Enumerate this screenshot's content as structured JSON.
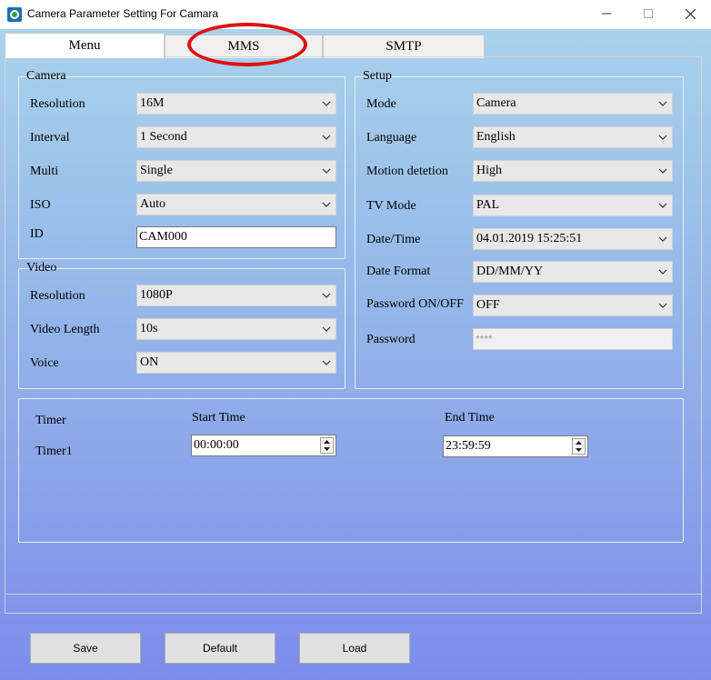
{
  "window": {
    "title": "Camera Parameter Setting For  Camara",
    "minimize_icon": "minimize-icon",
    "maximize_icon": "maximize-icon",
    "close_icon": "close-icon"
  },
  "tabs": [
    "Menu",
    "MMS",
    "SMTP"
  ],
  "active_tab": "Menu",
  "camera": {
    "group_title": "Camera",
    "resolution": {
      "label": "Resolution",
      "value": "16M"
    },
    "interval": {
      "label": "Interval",
      "value": "1 Second"
    },
    "multi": {
      "label": "Multi",
      "value": "Single"
    },
    "iso": {
      "label": "ISO",
      "value": "Auto"
    },
    "id": {
      "label": "ID",
      "value": "CAM000"
    }
  },
  "video": {
    "group_title": "Video",
    "resolution": {
      "label": "Resolution",
      "value": "1080P"
    },
    "length": {
      "label": "Video Length",
      "value": "10s"
    },
    "voice": {
      "label": "Voice",
      "value": "ON"
    }
  },
  "setup": {
    "group_title": "Setup",
    "mode": {
      "label": "Mode",
      "value": "Camera"
    },
    "language": {
      "label": "Language",
      "value": "English"
    },
    "motion": {
      "label": "Motion detetion",
      "value": "High"
    },
    "tv_mode": {
      "label": "TV Mode",
      "value": "PAL"
    },
    "datetime": {
      "label": "Date/Time",
      "value": "04.01.2019 15:25:51"
    },
    "date_format": {
      "label": "Date Format",
      "value": "DD/MM/YY"
    },
    "password_onoff": {
      "label": "Password ON/OFF",
      "value": "OFF"
    },
    "password": {
      "label": "Password",
      "value": "****"
    }
  },
  "timer": {
    "title": "Timer",
    "row_label": "Timer1",
    "start_label": "Start Time",
    "start_value": "00:00:00",
    "end_label": "End Time",
    "end_value": "23:59:59"
  },
  "buttons": {
    "save": "Save",
    "default": "Default",
    "load": "Load"
  },
  "colors": {
    "annotation": "#e01010",
    "gradient_top": "#a9d2ec",
    "gradient_bottom": "#7c8cec"
  }
}
